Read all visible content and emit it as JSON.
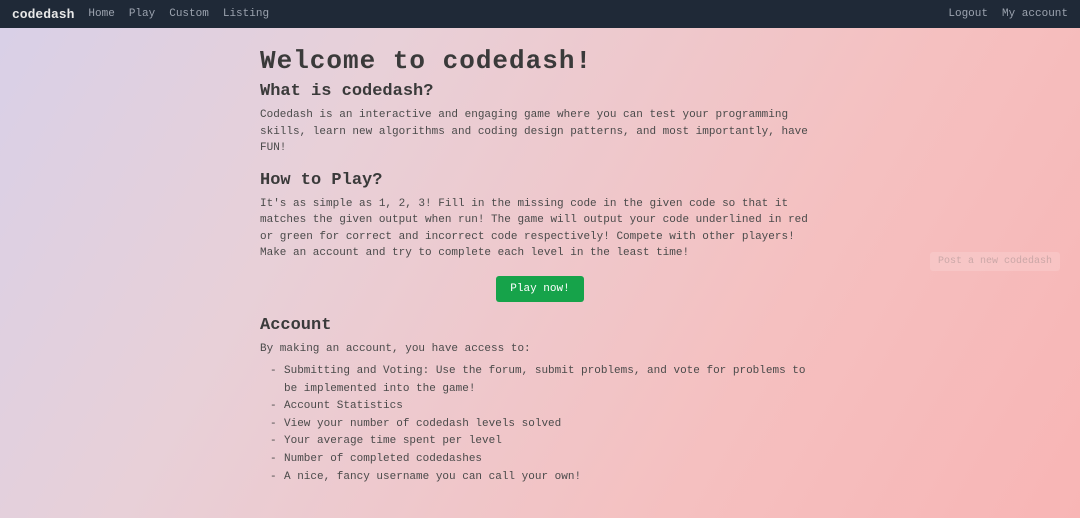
{
  "nav": {
    "brand": "codedash",
    "left": [
      "Home",
      "Play",
      "Custom",
      "Listing"
    ],
    "right": [
      "Logout",
      "My account"
    ]
  },
  "main": {
    "title": "Welcome to codedash!",
    "sections": {
      "what_is": {
        "heading": "What is codedash?",
        "body": "Codedash is an interactive and engaging game where you can test your programming skills, learn new algorithms and coding design patterns, and most importantly, have FUN!"
      },
      "how_to_play": {
        "heading": "How to Play?",
        "body": "It's as simple as 1, 2, 3! Fill in the missing code in the given code so that it matches the given output when run! The game will output your code underlined in red or green for correct and incorrect code respectively! Compete with other players! Make an account and try to complete each level in the least time!"
      },
      "account": {
        "heading": "Account",
        "intro": "By making an account, you have access to:",
        "items": [
          "Submitting and Voting: Use the forum, submit problems, and vote for problems to be implemented into the game!",
          "Account Statistics",
          "View your number of codedash levels solved",
          "Your average time spent per level",
          "Number of completed codedashes",
          "A nice, fancy username you can call your own!"
        ]
      }
    },
    "play_button": "Play now!",
    "ghost_button": "Post a new codedash"
  }
}
